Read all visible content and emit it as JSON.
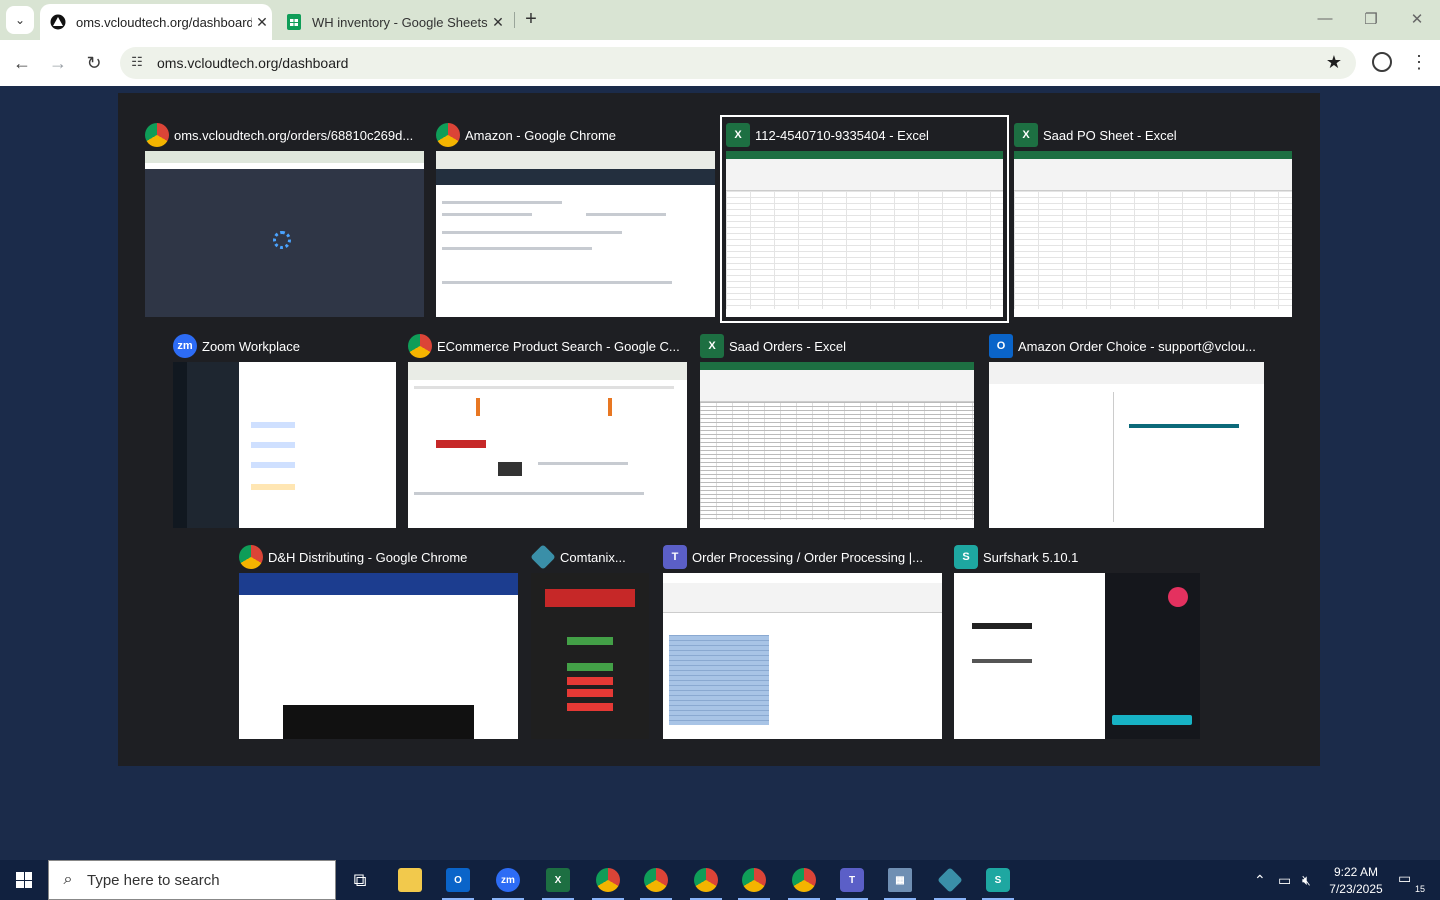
{
  "browser": {
    "tabs": [
      {
        "title": "oms.vcloudtech.org/dashboard",
        "active": true
      },
      {
        "title": "WH inventory - Google Sheets",
        "active": false
      }
    ],
    "url": "oms.vcloudtech.org/dashboard",
    "colors": {
      "tabstrip": "#d9e4d3",
      "omnibox": "#eef2ea"
    }
  },
  "task_view": {
    "windows": [
      {
        "title": "oms.vcloudtech.org/orders/68810c269d...",
        "icon": "chrome-icon",
        "selected": false
      },
      {
        "title": "Amazon - Google Chrome",
        "icon": "chrome-icon",
        "selected": false
      },
      {
        "title": "112-4540710-9335404 - Excel",
        "icon": "excel-icon",
        "selected": true
      },
      {
        "title": "Saad PO Sheet - Excel",
        "icon": "excel-icon",
        "selected": false
      },
      {
        "title": "Zoom Workplace",
        "icon": "zoom-icon",
        "selected": false
      },
      {
        "title": "ECommerce Product Search - Google C...",
        "icon": "chrome-icon",
        "selected": false
      },
      {
        "title": "Saad Orders - Excel",
        "icon": "excel-icon",
        "selected": false
      },
      {
        "title": "Amazon Order Choice - support@vclou...",
        "icon": "outlook-icon",
        "selected": false
      },
      {
        "title": "D&H Distributing - Google Chrome",
        "icon": "chrome-icon",
        "selected": false
      },
      {
        "title": "Comtanix...",
        "icon": "comtanix-icon",
        "selected": false
      },
      {
        "title": "Order Processing / Order Processing |...",
        "icon": "teams-icon",
        "selected": false
      },
      {
        "title": "Surfshark 5.10.1",
        "icon": "surfshark-icon",
        "selected": false
      }
    ]
  },
  "taskbar": {
    "search_placeholder": "Type here to search",
    "time": "9:22 AM",
    "date": "7/23/2025",
    "notification_count": "15",
    "apps": [
      "task-view-icon",
      "file-explorer-icon",
      "outlook-icon",
      "zoom-icon",
      "excel-icon",
      "chrome-icon",
      "chrome-icon",
      "chrome-icon",
      "chrome-icon",
      "chrome-icon",
      "teams-icon",
      "calculator-icon",
      "comtanix-icon",
      "surfshark-icon"
    ]
  }
}
